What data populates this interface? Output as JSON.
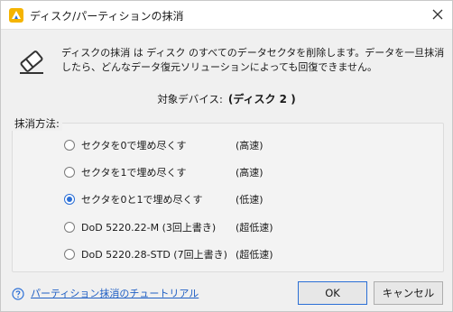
{
  "window": {
    "title": "ディスク/パーティションの抹消"
  },
  "description": "ディスクの抹消 は ディスク のすべてのデータセクタを削除します。データを一旦抹消したら、どんなデータ復元ソリューションによっても回復できません。",
  "target": {
    "label": "対象デバイス:",
    "value": "(ディスク 2 )"
  },
  "method_group": {
    "label": "抹消方法:",
    "options": [
      {
        "label": "セクタを0で埋め尽くす",
        "speed": "(高速)",
        "selected": false
      },
      {
        "label": "セクタを1で埋め尽くす",
        "speed": "(高速)",
        "selected": false
      },
      {
        "label": "セクタを0と1で埋め尽くす",
        "speed": "(低速)",
        "selected": true
      },
      {
        "label": "DoD 5220.22-M (3回上書き)",
        "speed": "(超低速)",
        "selected": false
      },
      {
        "label": "DoD 5220.28-STD (7回上書き)",
        "speed": "(超低速)",
        "selected": false
      }
    ]
  },
  "footer": {
    "tutorial_link": "パーティション抹消のチュートリアル",
    "ok_label": "OK",
    "cancel_label": "キャンセル"
  },
  "colors": {
    "accent": "#2b6fd6",
    "link": "#1f5fc4"
  }
}
